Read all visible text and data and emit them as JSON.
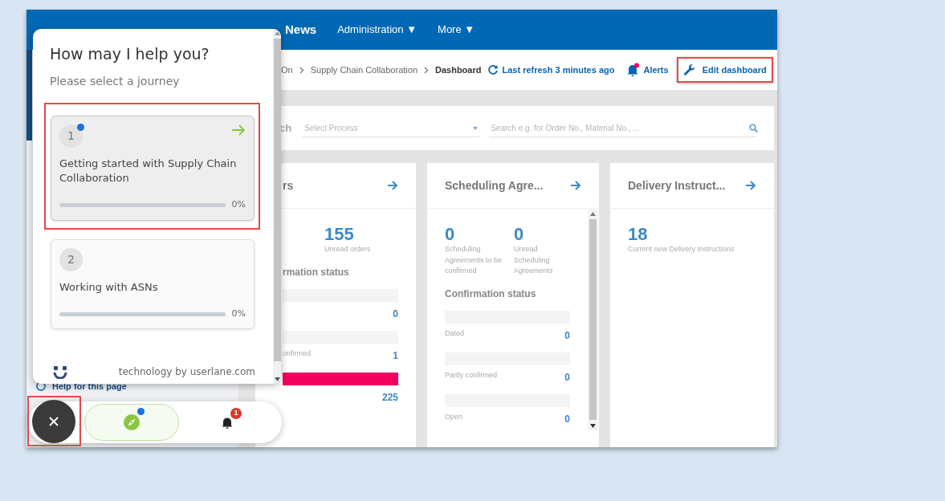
{
  "navbar": {
    "items": [
      {
        "label": "News",
        "kind": "bold"
      },
      {
        "label": "Administration",
        "caret": "▼",
        "kind": "normal"
      },
      {
        "label": "More",
        "caret": "▼",
        "kind": "normal"
      }
    ]
  },
  "sidebar": {
    "help_link": "Help for this page"
  },
  "toolbar": {
    "breadcrumbs": [
      "On",
      "Supply Chain Collaboration",
      "Dashboard"
    ],
    "refresh": "Last refresh 3 minutes ago",
    "alerts": {
      "label": "Alerts",
      "unread": true
    },
    "edit_dashboard": {
      "label": "Edit dashboard",
      "highlighted": true
    }
  },
  "search": {
    "label": "ch",
    "process_placeholder": "Select Process",
    "search_placeholder": "Search e.g. for Order No., Material No., ..."
  },
  "widgets": [
    {
      "title": "rs",
      "stats": [
        {
          "value": "155",
          "label": "Unread orders"
        }
      ],
      "status_heading": "rmation status",
      "status_rows": [
        {
          "value": "0",
          "level": 0
        },
        {
          "label": "onfirmed",
          "value": "1",
          "level": 0
        },
        {
          "value": "225",
          "level": 1
        }
      ],
      "scrollbar": false
    },
    {
      "title": "Scheduling Agre...",
      "stats": [
        {
          "value": "0",
          "label": "Scheduling Agreements to be confirmed"
        },
        {
          "value": "0",
          "label": "Unread Scheduling Agreements"
        }
      ],
      "status_heading": "Confirmation status",
      "status_rows": [
        {
          "label": "Dated",
          "value": "0",
          "level": 0
        },
        {
          "label": "Partly confirmed",
          "value": "0",
          "level": 0
        },
        {
          "label": "Open",
          "value": "0",
          "level": 0
        }
      ],
      "scrollbar": true
    },
    {
      "title": "Delivery Instruct...",
      "stats": [
        {
          "value": "18",
          "label": "Current new Delivery Instructions"
        }
      ],
      "scrollbar": false
    }
  ],
  "assistant": {
    "title": "How may I help you?",
    "subtitle": "Please select a journey",
    "journeys": [
      {
        "number": "1",
        "title": "Getting started with Supply Chain Collaboration",
        "level": 0,
        "percent": "0%",
        "new": true,
        "selected": true,
        "highlighted": true
      },
      {
        "number": "2",
        "title": "Working with ASNs",
        "level": 0,
        "percent": "0%",
        "new": false,
        "selected": false,
        "highlighted": false
      }
    ],
    "footer": "technology by userlane.com"
  },
  "launcher": {
    "avatar_highlighted": true,
    "guide_new": true,
    "notification_count": "1"
  }
}
